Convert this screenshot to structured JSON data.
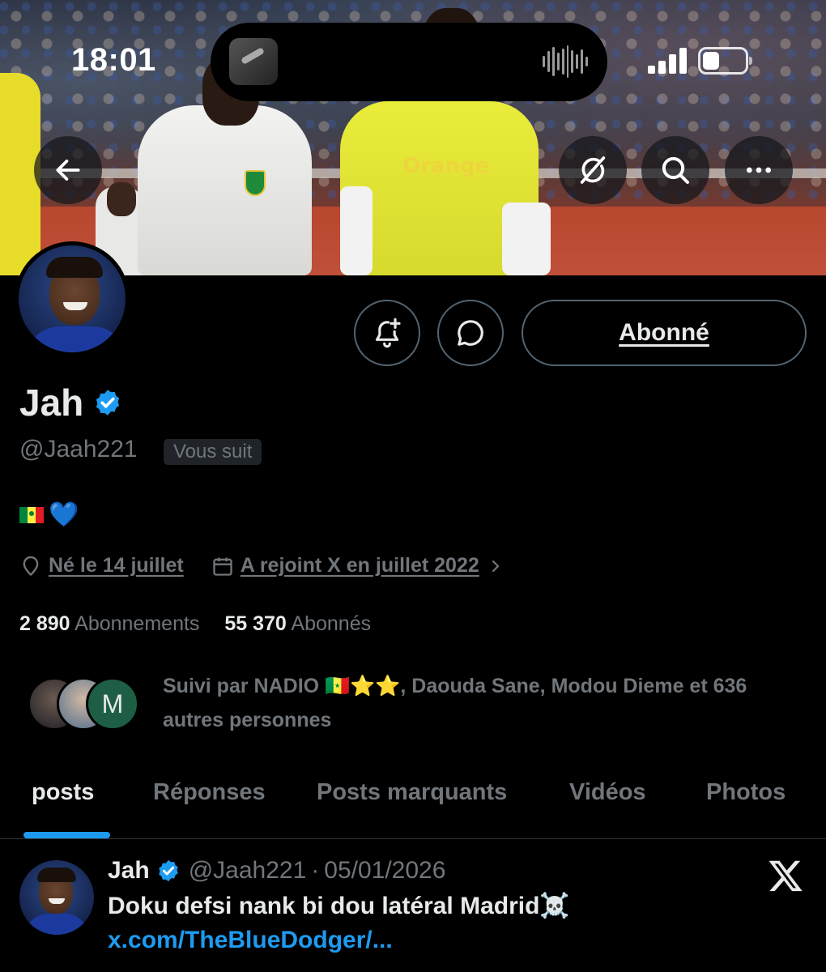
{
  "status_bar": {
    "time": "18:01"
  },
  "banner": {
    "jersey_text": "Orange"
  },
  "profile": {
    "name": "Jah",
    "handle": "@Jaah221",
    "follows_you_badge": "Vous suit",
    "bio_emoji": "💙",
    "birthday": "Né le 14 juillet",
    "joined": "A rejoint X en juillet 2022",
    "following_count": "2 890",
    "following_label": "Abonnements",
    "followers_count": "55 370",
    "followers_label": "Abonnés",
    "followed_by_text": "Suivi par NADIO 🇸🇳⭐⭐, Daouda Sane, Modou Dieme et 636 autres personnes",
    "followed_avatar_initial": "M"
  },
  "actions": {
    "follow_button_label": "Abonné"
  },
  "tabs": [
    {
      "label": "posts"
    },
    {
      "label": "Réponses"
    },
    {
      "label": "Posts marquants"
    },
    {
      "label": "Vidéos"
    },
    {
      "label": "Photos"
    }
  ],
  "post": {
    "author": "Jah",
    "handle": "@Jaah221",
    "date": "05/01/2026",
    "separator": "·",
    "text": "Doku defsi nank bi dou latéral Madrid",
    "emoji": "☠️",
    "link": "x.com/TheBlueDodger/..."
  },
  "colors": {
    "accent": "#1d9bf0",
    "muted": "#71767b",
    "text": "#e7e9ea",
    "background": "#000000",
    "verified": "#1d9bf0"
  },
  "icons": {
    "back": "arrow-left-icon",
    "grok": "grok-icon",
    "search": "search-icon",
    "more": "more-horizontal-icon",
    "notify": "bell-plus-icon",
    "message": "message-bubble-icon",
    "location": "location-pin-icon",
    "calendar": "calendar-icon",
    "verified": "verified-badge-icon",
    "x_logo": "x-logo-icon"
  }
}
